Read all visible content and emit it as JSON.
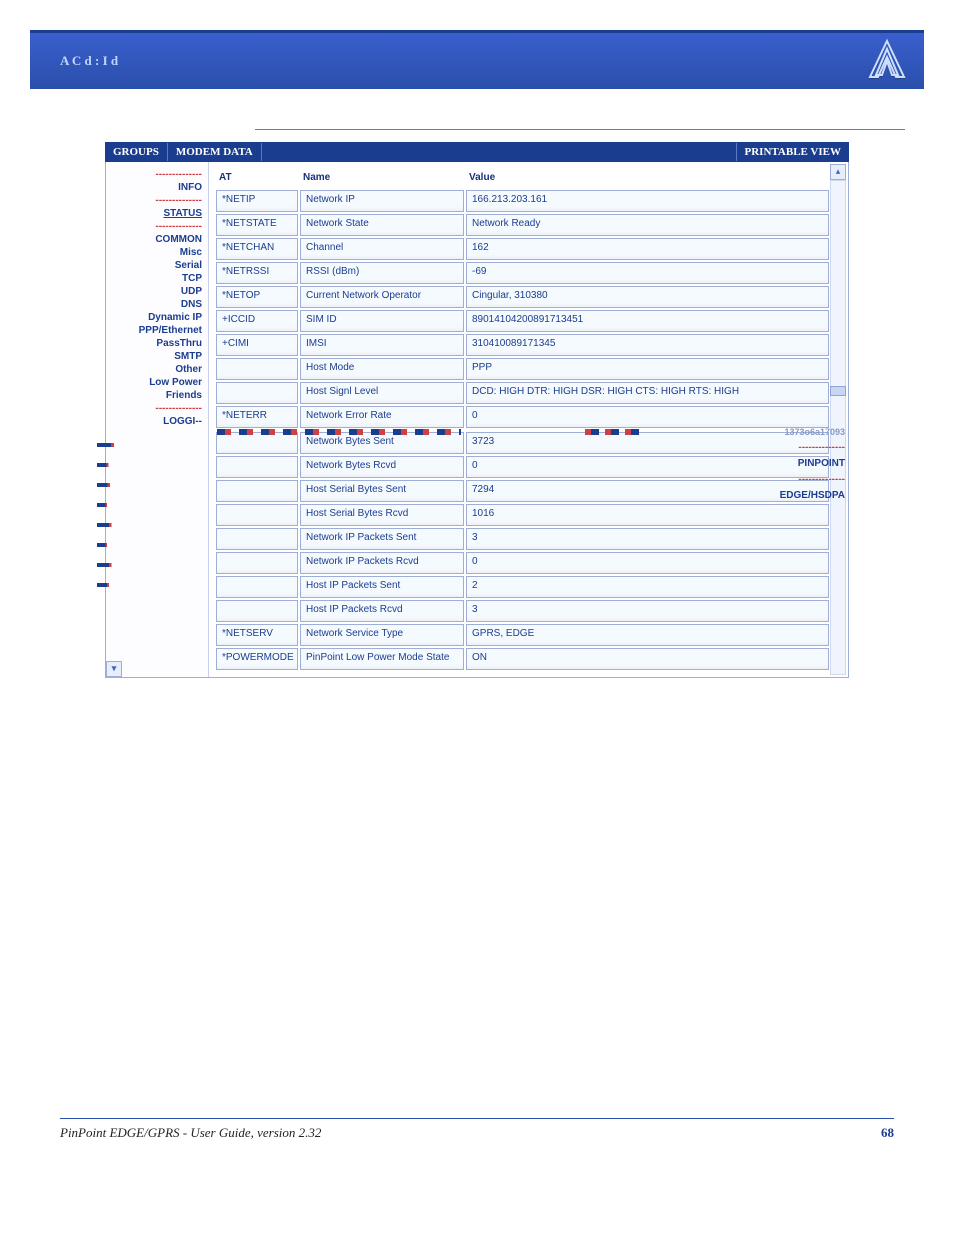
{
  "header_text": "A C    d : I            d",
  "topbar": {
    "groups": "GROUPS",
    "modem_data": "MODEM DATA",
    "printable_view": "PRINTABLE VIEW"
  },
  "sidebar": {
    "sep": "--------------",
    "info": "INFO",
    "status": "STATUS",
    "common": "COMMON",
    "misc": "Misc",
    "serial": "Serial",
    "tcp": "TCP",
    "udp": "UDP",
    "dns": "DNS",
    "dynamic_ip": "Dynamic IP",
    "ppp_ethernet": "PPP/Ethernet",
    "passthru": "PassThru",
    "smtp": "SMTP",
    "other": "Other",
    "low_power": "Low Power",
    "friends": "Friends",
    "logging_cut": "LOGGI--",
    "garble": "1373o6a17093",
    "pinpoint": "PINPOINT",
    "edge_hsdpa": "EDGE/HSDPA"
  },
  "columns": {
    "at": "AT",
    "name": "Name",
    "value": "Value"
  },
  "rows_top": [
    {
      "at": "*NETIP",
      "name": "Network IP",
      "value": "166.213.203.161"
    },
    {
      "at": "*NETSTATE",
      "name": "Network State",
      "value": "Network Ready"
    },
    {
      "at": "*NETCHAN",
      "name": "Channel",
      "value": "162"
    },
    {
      "at": "*NETRSSI",
      "name": "RSSI (dBm)",
      "value": "-69"
    },
    {
      "at": "*NETOP",
      "name": "Current Network Operator",
      "value": "Cingular, 310380"
    },
    {
      "at": "+ICCID",
      "name": "SIM ID",
      "value": "89014104200891713451"
    },
    {
      "at": "+CIMI",
      "name": "IMSI",
      "value": "310410089171345"
    },
    {
      "at": "",
      "name": "Host Mode",
      "value": "PPP"
    },
    {
      "at": "",
      "name": "Host Signl Level",
      "value": "DCD: HIGH DTR: HIGH DSR: HIGH CTS: HIGH RTS: HIGH"
    },
    {
      "at": "*NETERR",
      "name": "Network Error Rate",
      "value": "0"
    }
  ],
  "rows_bottom": [
    {
      "at": "",
      "name": "Network Bytes Sent",
      "value": "3723"
    },
    {
      "at": "",
      "name": "Network Bytes Rcvd",
      "value": "0"
    },
    {
      "at": "",
      "name": "Host Serial Bytes Sent",
      "value": "7294"
    },
    {
      "at": "",
      "name": "Host Serial Bytes Rcvd",
      "value": "1016"
    },
    {
      "at": "",
      "name": "Network IP Packets Sent",
      "value": "3"
    },
    {
      "at": "",
      "name": "Network IP Packets Rcvd",
      "value": "0"
    },
    {
      "at": "",
      "name": "Host IP Packets Sent",
      "value": "2"
    },
    {
      "at": "",
      "name": "Host IP Packets Rcvd",
      "value": "3"
    },
    {
      "at": "*NETSERV",
      "name": "Network Service Type",
      "value": "GPRS, EDGE"
    },
    {
      "at": "*POWERMODE",
      "name": "PinPoint Low Power Mode State",
      "value": "ON"
    }
  ],
  "footer": {
    "title": "PinPoint EDGE/GPRS - User Guide, version 2.32",
    "page": "68"
  }
}
